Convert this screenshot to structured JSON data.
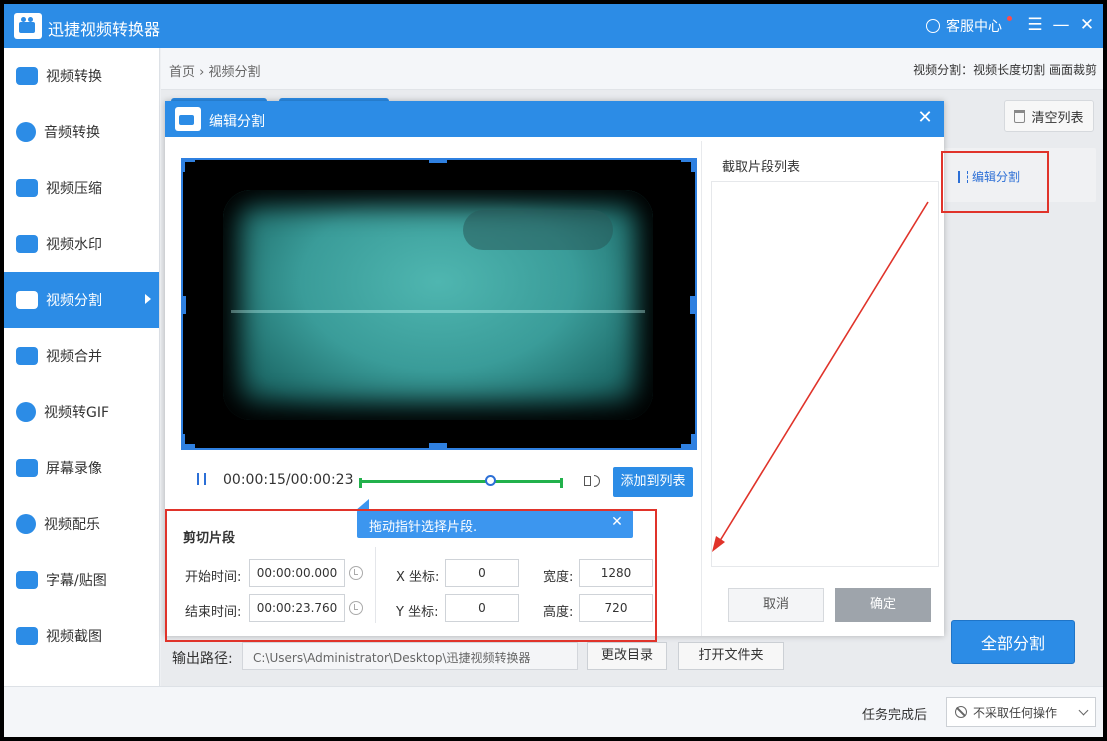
{
  "app": {
    "title": "迅捷视频转换器",
    "customer_service": "客服中心"
  },
  "sidebar": {
    "items": [
      {
        "label": "视频转换",
        "icon": "video-convert-icon"
      },
      {
        "label": "音频转换",
        "icon": "audio-convert-icon"
      },
      {
        "label": "视频压缩",
        "icon": "video-compress-icon"
      },
      {
        "label": "视频水印",
        "icon": "video-watermark-icon"
      },
      {
        "label": "视频分割",
        "icon": "video-split-icon",
        "active": true
      },
      {
        "label": "视频合并",
        "icon": "video-merge-icon"
      },
      {
        "label": "视频转GIF",
        "icon": "video-gif-icon"
      },
      {
        "label": "屏幕录像",
        "icon": "screen-record-icon"
      },
      {
        "label": "视频配乐",
        "icon": "video-music-icon"
      },
      {
        "label": "字幕/贴图",
        "icon": "subtitle-icon"
      },
      {
        "label": "视频截图",
        "icon": "video-screenshot-icon"
      }
    ]
  },
  "breadcrumb": {
    "home": "首页",
    "separator": "›",
    "current": "视频分割"
  },
  "split_mode": "视频分割：视频长度切割 画面裁剪",
  "main": {
    "clear_list": "清空列表",
    "edit_split": "编辑分割",
    "split_all": "全部分割"
  },
  "output": {
    "label": "输出路径:",
    "path": "C:\\Users\\Administrator\\Desktop\\迅捷视频转换器",
    "change_dir": "更改目录",
    "open_folder": "打开文件夹"
  },
  "bottom": {
    "after_label": "任务完成后",
    "after_value": "不采取任何操作"
  },
  "dialog": {
    "title": "编辑分割",
    "time_display": "00:00:15/00:00:23",
    "playback_fraction": 0.65,
    "add_to_list": "添加到列表",
    "tooltip": "拖动指针选择片段.",
    "cut_section_title": "剪切片段",
    "start_label": "开始时间:",
    "start_value": "00:00:00.000",
    "end_label": "结束时间:",
    "end_value": "00:00:23.760",
    "x_label": "X 坐标:",
    "x_value": "0",
    "y_label": "Y 坐标:",
    "y_value": "0",
    "width_label": "宽度:",
    "width_value": "1280",
    "height_label": "高度:",
    "height_value": "720",
    "list_title": "截取片段列表",
    "cancel": "取消",
    "confirm": "确定"
  },
  "colors": {
    "accent": "#2c8ce6",
    "annotation": "#e0332a",
    "range": "#22b14c"
  }
}
